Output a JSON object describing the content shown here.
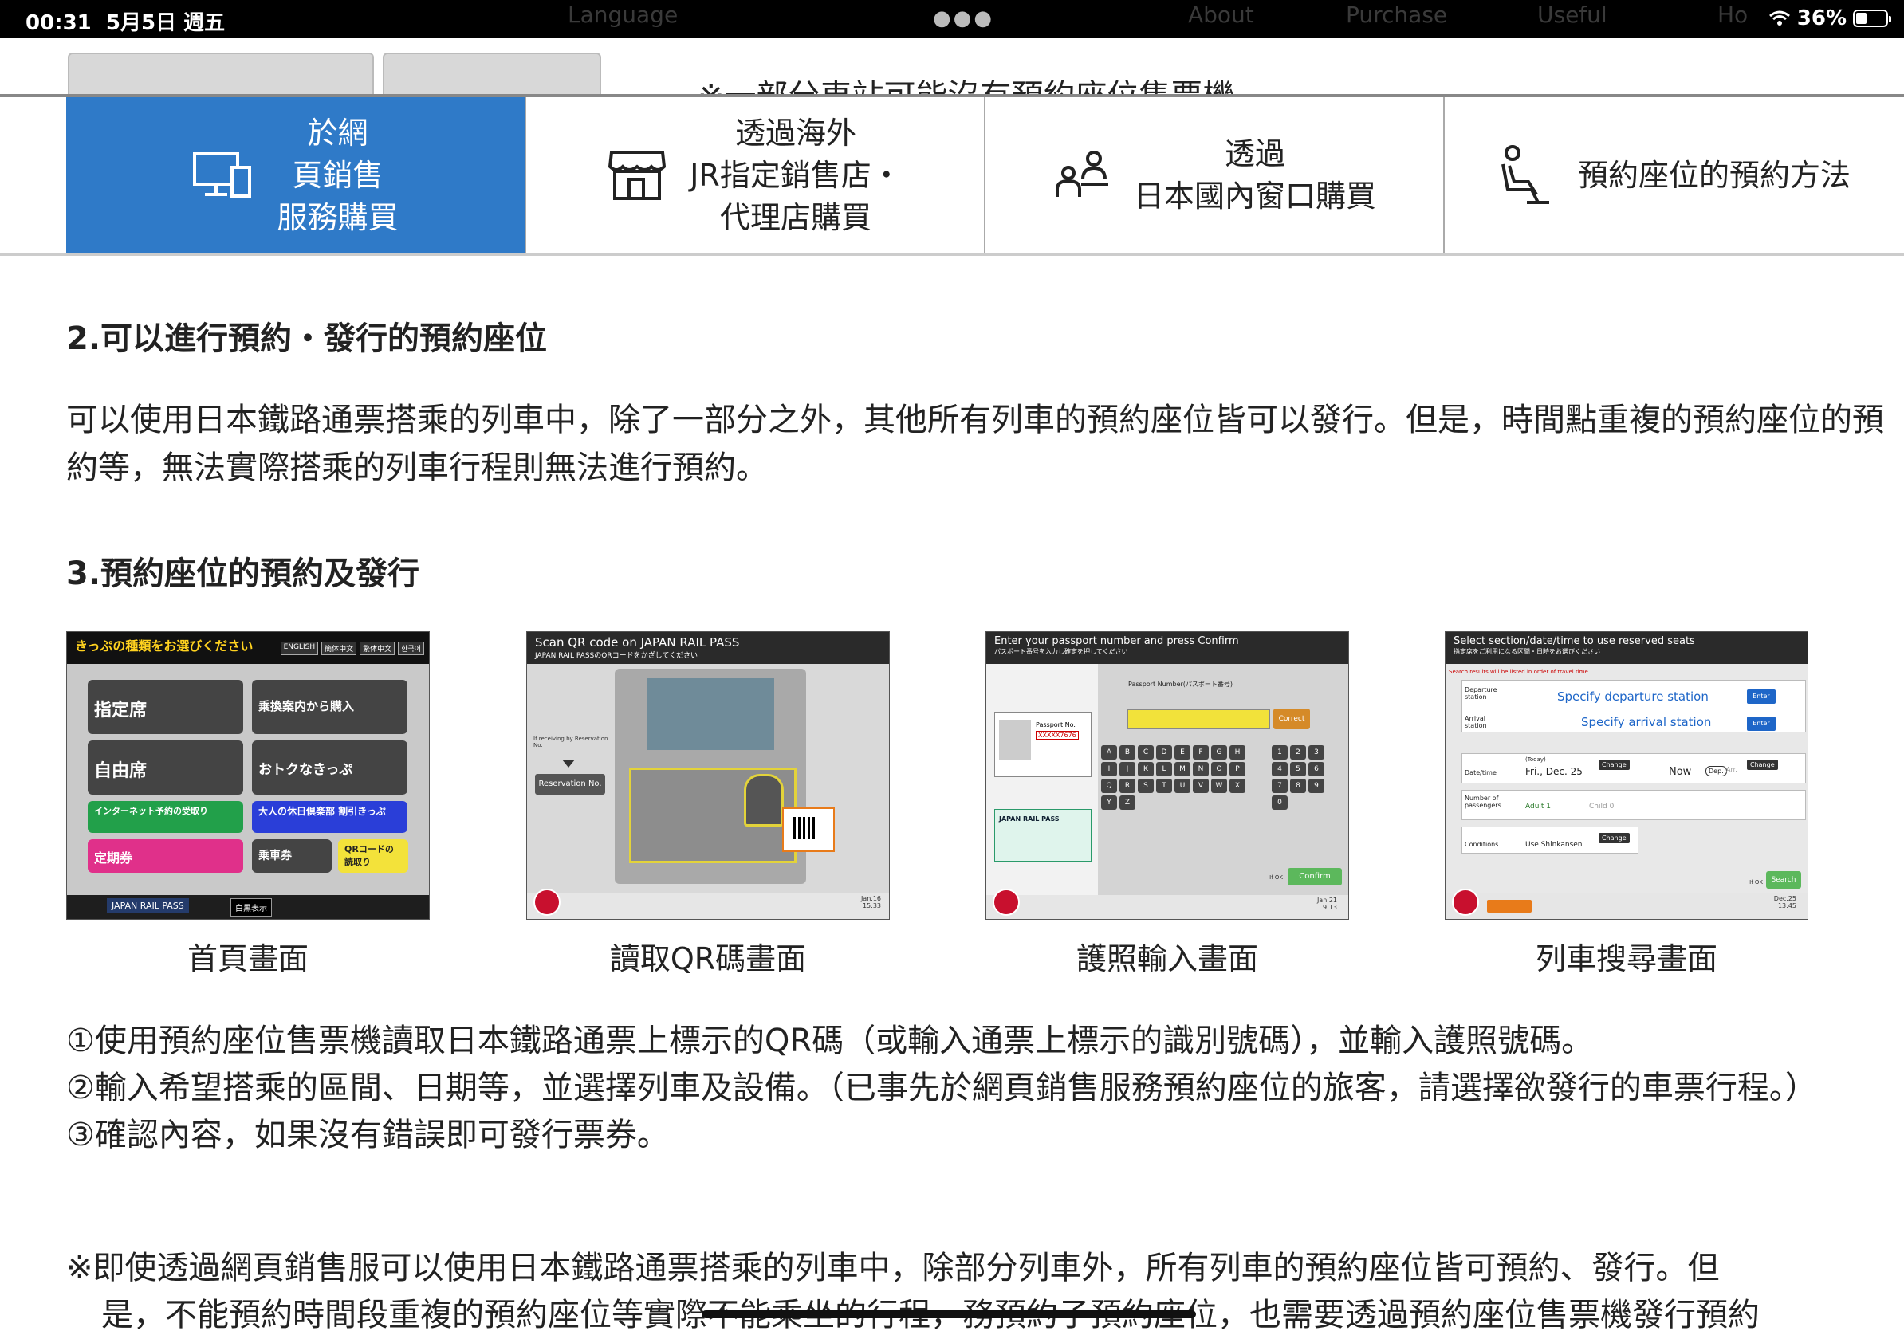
{
  "status_bar": {
    "time": "00:31",
    "date": "5月5日 週五",
    "battery": "36%",
    "battery_fraction": 0.36,
    "ghost_menu": [
      "Language",
      "About",
      "Purchase",
      "Useful",
      "Ho"
    ]
  },
  "behind_note": "※一部分車站可能沒有預約座位售票機。",
  "tabs": [
    {
      "label": "於網\n頁銷售\n服務購買",
      "icon": "monitor-icon",
      "active": true
    },
    {
      "label": "透過海外\nJR指定銷售店・\n代理店購買",
      "icon": "store-icon",
      "active": false
    },
    {
      "label": "透過\n日本國內窗口購買",
      "icon": "people-icon",
      "active": false
    },
    {
      "label": "預約座位的預約方法",
      "icon": "seat-icon",
      "active": false
    }
  ],
  "section2": {
    "heading": "2.可以進行預約・發行的預約座位",
    "body": "可以使用日本鐵路通票搭乘的列車中，除了一部分之外，其他所有列車的預約座位皆可以發行。但是，時間點重複的預約座位的預約等，無法實際搭乘的列車行程則無法進行預約。"
  },
  "section3": {
    "heading": "3.預約座位的預約及發行",
    "screens": [
      {
        "caption": "首頁畫面",
        "title": "きっぷの種類をお選びください",
        "lang_buttons": [
          "ENGLISH",
          "簡体中文",
          "繁体中文",
          "한국어"
        ],
        "tiles": [
          "指定席",
          "乗換案内から購入",
          "自由席",
          "おトクなきっぷ",
          "インターネット予約の受取り",
          "大人の休日倶楽部 割引きっぷ",
          "定期券",
          "乗車券",
          "QRコードの読取り"
        ],
        "footer_brand": "JAPAN RAIL PASS",
        "footer_btn": "白黒表示"
      },
      {
        "caption": "讀取QR碼畫面",
        "title": "Scan QR code on JAPAN RAIL PASS",
        "subtitle": "JAPAN RAIL PASSのQRコードをかざしてください",
        "side_text": "If receiving by Reservation No.",
        "side_button": "Reservation No.",
        "cancel": "Cancel",
        "date": "Jan.16",
        "time": "15:33"
      },
      {
        "caption": "護照輸入畫面",
        "title": "Enter your passport number and press Confirm",
        "subtitle": "パスポート番号を入力し確定を押してください",
        "field_label": "Passport Number(パスポート番号)",
        "correct": "Correct",
        "confirm": "Confirm",
        "passport_label": "Passport No.",
        "passport_value": "XXXXX7676",
        "pass_card": "JAPAN RAIL PASS",
        "keys_alpha": [
          "A",
          "B",
          "C",
          "D",
          "E",
          "F",
          "G",
          "H",
          "I",
          "J",
          "K",
          "L",
          "M",
          "N",
          "O",
          "P",
          "Q",
          "R",
          "S",
          "T",
          "U",
          "V",
          "W",
          "X",
          "Y",
          "Z"
        ],
        "keys_num": [
          "1",
          "2",
          "3",
          "4",
          "5",
          "6",
          "7",
          "8",
          "9",
          "0"
        ],
        "cancel": "Cancel",
        "if_ok": "If OK",
        "date": "Jan.21",
        "time": "9:13"
      },
      {
        "caption": "列車搜尋畫面",
        "title": "Select section/date/time to use reserved seats",
        "subtitle": "指定席をご利用になる区間・日時をお選びください",
        "notice": "Search results will be listed in order of travel time.",
        "dep_label": "Departure station",
        "dep_value": "Specify departure station",
        "arr_label": "Arrival station",
        "arr_value": "Specify arrival station",
        "enter": "Enter",
        "date_label": "Date/time",
        "date_value": "Fri., Dec. 25",
        "today": "(Today)",
        "time_value": "Now",
        "dep_badge": "Dep.",
        "arr_badge": "Arr.",
        "change": "Change",
        "passengers_label": "Number of passengers",
        "adult": "Adult 1",
        "child": "Child 0",
        "conditions_label": "Conditions",
        "conditions_value": "Use Shinkansen",
        "search": "Search",
        "if_ok": "If OK",
        "cancel": "Cancel",
        "date": "Dec.25",
        "time": "13:45"
      }
    ],
    "steps": [
      "①使用預約座位售票機讀取日本鐵路通票上標示的QR碼（或輸入通票上標示的識別號碼），並輸入護照號碼。",
      "②輸入希望搭乘的區間、日期等，並選擇列車及設備。（已事先於網頁銷售服務預約座位的旅客，請選擇欲發行的車票行程。）",
      "③確認內容，如果沒有錯誤即可發行票券。"
    ],
    "note_line1": "※即使透過網頁銷售服可以使用日本鐵路通票搭乘的列車中，除部分列車外，所有列車的預約座位皆可預約、發行。但",
    "note_line2": "是，不能預約時間段重複的預約座位等實際不能乘坐的行程，務預約子預約座位，也需要透過預約座位售票機發行預約"
  },
  "colors": {
    "tab_active": "#2f7ac8",
    "cancel_red": "#c8102e",
    "confirm_green": "#5cb85c",
    "enter_blue": "#1e66c8"
  }
}
